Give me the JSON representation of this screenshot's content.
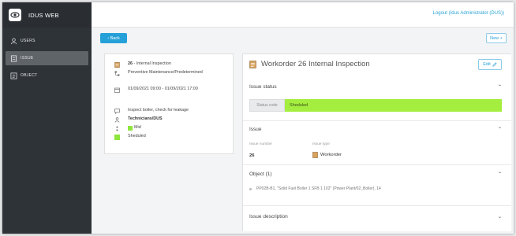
{
  "app": {
    "title": "IDUS WEB"
  },
  "header": {
    "logout": "Logout (Idus Administrator (DUS))"
  },
  "sidebar": {
    "items": [
      {
        "label": "USERS",
        "icon": "user-icon"
      },
      {
        "label": "ISSUE",
        "icon": "document-icon",
        "active": true
      },
      {
        "label": "OBJECT",
        "icon": "list-icon"
      }
    ]
  },
  "toolbar": {
    "back_label": "‹ Back",
    "new_label": "New +"
  },
  "summary": {
    "title_number": "26",
    "title_text": " - Internal Inspection",
    "type": "Preventive Maintenance/Predetermined",
    "dates": "01/09/2021 09:00 - 01/09/2021 17:00",
    "description": "Inspect boiler, check for leakage",
    "group": "Technicians/DUS",
    "priority": "Mid",
    "status": "Sheduled"
  },
  "detail": {
    "title": "Workorder 26 Internal Inspection",
    "edit_label": "Edit",
    "issue_status": {
      "heading": "Issue status",
      "code_label": "Status code",
      "code_value": "Sheduled"
    },
    "issue": {
      "heading": "Issue",
      "number_label": "Issue number",
      "number_value": "26",
      "type_label": "Issue type",
      "type_value": "Workorder"
    },
    "object": {
      "heading": "Object  (1)",
      "item": "PP02B-B1, \"Solid Fuel Boiler 1 SFB 1 102\" (Power Plant/02_Boiler), 14"
    },
    "description": {
      "heading": "Issue description"
    }
  },
  "colors": {
    "sidebar": "#2e3338",
    "accent": "#25a0d8",
    "status_green": "#a4ee3f",
    "priority_green": "#8ee63d"
  }
}
